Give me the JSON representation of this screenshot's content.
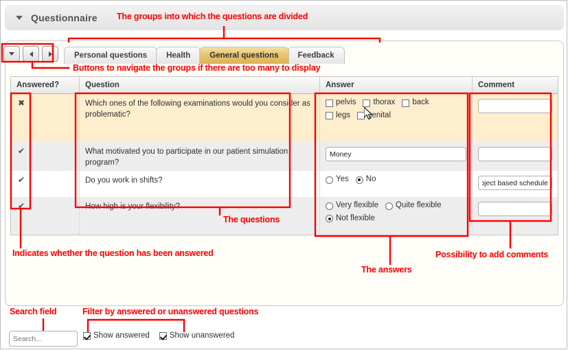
{
  "panel": {
    "title": "Questionnaire",
    "collapse_icon": "caret-down-icon"
  },
  "tab_nav": {
    "dropdown_icon": "caret-down-icon",
    "prev_icon": "caret-left-icon",
    "next_icon": "caret-right-icon"
  },
  "tabs": [
    {
      "label": "Personal questions",
      "active": false
    },
    {
      "label": "Health",
      "active": false
    },
    {
      "label": "General questions",
      "active": true
    },
    {
      "label": "Feedback",
      "active": false
    }
  ],
  "grid": {
    "headers": {
      "answered": "Answered?",
      "question": "Question",
      "answer": "Answer",
      "comment": "Comment"
    },
    "rows": [
      {
        "answered_symbol": "✖",
        "answered_state": "unanswered",
        "question": "Which ones of the following examinations would you consider as problematic?",
        "answer_type": "checkbox",
        "options": [
          {
            "label": "pelvis",
            "checked": false
          },
          {
            "label": "thorax",
            "checked": false
          },
          {
            "label": "back",
            "checked": false
          },
          {
            "label": "legs",
            "checked": false
          },
          {
            "label": "genital",
            "checked": false
          }
        ],
        "comment": ""
      },
      {
        "answered_symbol": "✔",
        "answered_state": "answered",
        "question": "What motivated you to participate in our patient simulation program?",
        "answer_type": "text",
        "answer_value": "Money",
        "comment": ""
      },
      {
        "answered_symbol": "✔",
        "answered_state": "answered",
        "question": "Do you work in shifts?",
        "answer_type": "radio",
        "options": [
          {
            "label": "Yes",
            "checked": false
          },
          {
            "label": "No",
            "checked": true
          }
        ],
        "comment": "oject based schedule"
      },
      {
        "answered_symbol": "✔",
        "answered_state": "answered",
        "question": "How high is your flexibility?",
        "answer_type": "radio",
        "options": [
          {
            "label": "Very flexible",
            "checked": false
          },
          {
            "label": "Quite flexible",
            "checked": false
          },
          {
            "label": "Not flexible",
            "checked": true
          }
        ],
        "comment": ""
      }
    ]
  },
  "toolbar": {
    "search_placeholder": "Search...",
    "search_value": "",
    "filters": [
      {
        "label": "Show answered",
        "checked": true
      },
      {
        "label": "Show unanswered",
        "checked": true
      }
    ]
  },
  "annotations": {
    "groups": "The groups into which the questions are divided",
    "nav_buttons": "Buttons to navigate the groups if there are too many to display",
    "questions": "The questions",
    "answers": "The answers",
    "comments": "Possibility to add comments",
    "answered_indicator": "Indicates whether the question has been answered",
    "search_field": "Search field",
    "filter": "Filter by answered or unanswered questions"
  },
  "colors": {
    "annotation_red": "#fc0000",
    "active_tab": "#e6c470",
    "selected_row": "#fdeecd",
    "alt_row": "#ededed",
    "panel_bg": "#fffef8"
  }
}
